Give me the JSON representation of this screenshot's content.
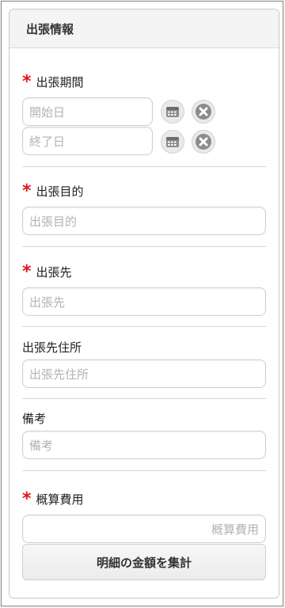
{
  "panel": {
    "title": "出張情報"
  },
  "period": {
    "label": "出張期間",
    "required": true,
    "start_placeholder": "開始日",
    "end_placeholder": "終了日"
  },
  "purpose": {
    "label": "出張目的",
    "required": true,
    "placeholder": "出張目的"
  },
  "destination": {
    "label": "出張先",
    "required": true,
    "placeholder": "出張先"
  },
  "address": {
    "label": "出張先住所",
    "placeholder": "出張先住所"
  },
  "remarks": {
    "label": "備考",
    "placeholder": "備考"
  },
  "estimate": {
    "label": "概算費用",
    "required": true,
    "placeholder": "概算費用",
    "sum_button_label": "明細の金額を集計"
  },
  "required_mark": "*",
  "icons": {
    "calendar": "calendar-icon",
    "clear": "clear-icon"
  },
  "colors": {
    "required": "#e0161b"
  }
}
